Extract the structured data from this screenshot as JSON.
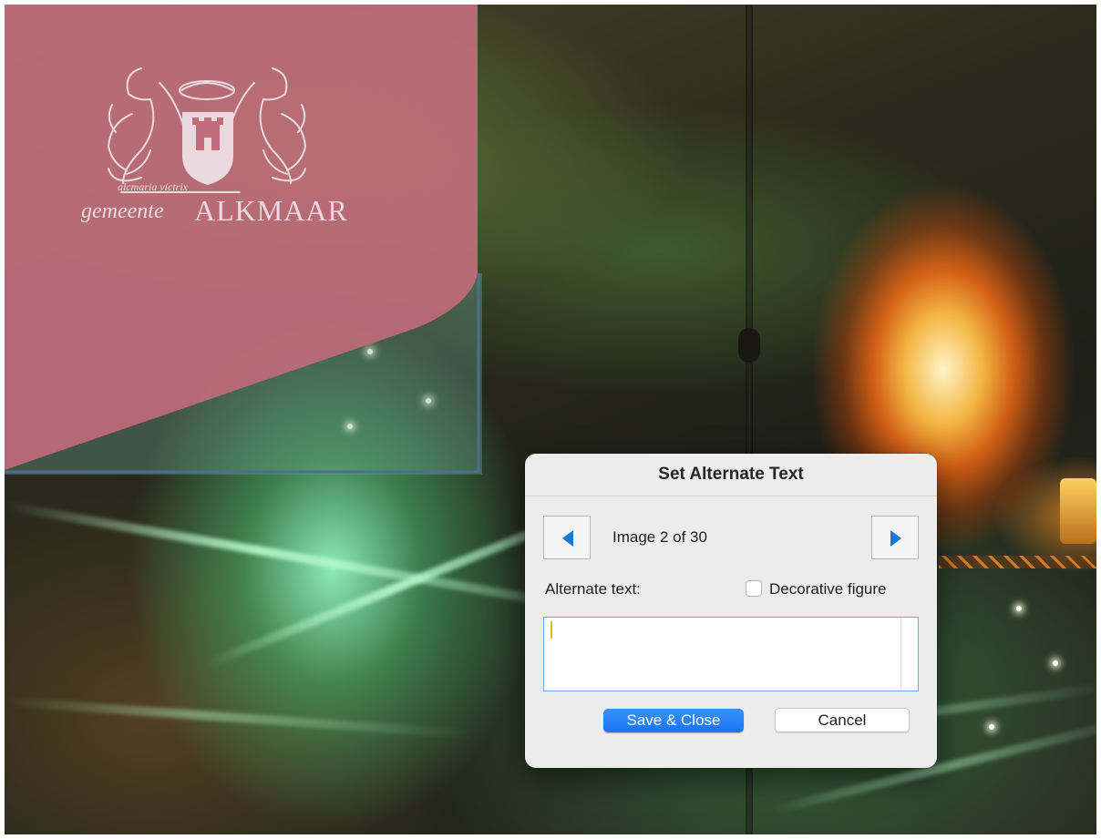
{
  "background": {
    "description_icon": "fireworks-photo",
    "accent": "#ff8a2a"
  },
  "brand": {
    "motto": "alcmaria victrix",
    "prefix": "gemeente",
    "name": "ALKMAAR",
    "panel_color": "#bf6e7a",
    "logo_color": "#ead9de"
  },
  "dialog": {
    "title": "Set Alternate Text",
    "prev_icon": "triangle-left-icon",
    "next_icon": "triangle-right-icon",
    "counter": "Image 2 of 30",
    "alt_label": "Alternate text:",
    "alt_value": "",
    "decorative_label": "Decorative figure",
    "decorative_checked": false,
    "save_label": "Save & Close",
    "cancel_label": "Cancel",
    "arrow_color": "#1b78d0",
    "primary_color": "#1a73f0"
  }
}
